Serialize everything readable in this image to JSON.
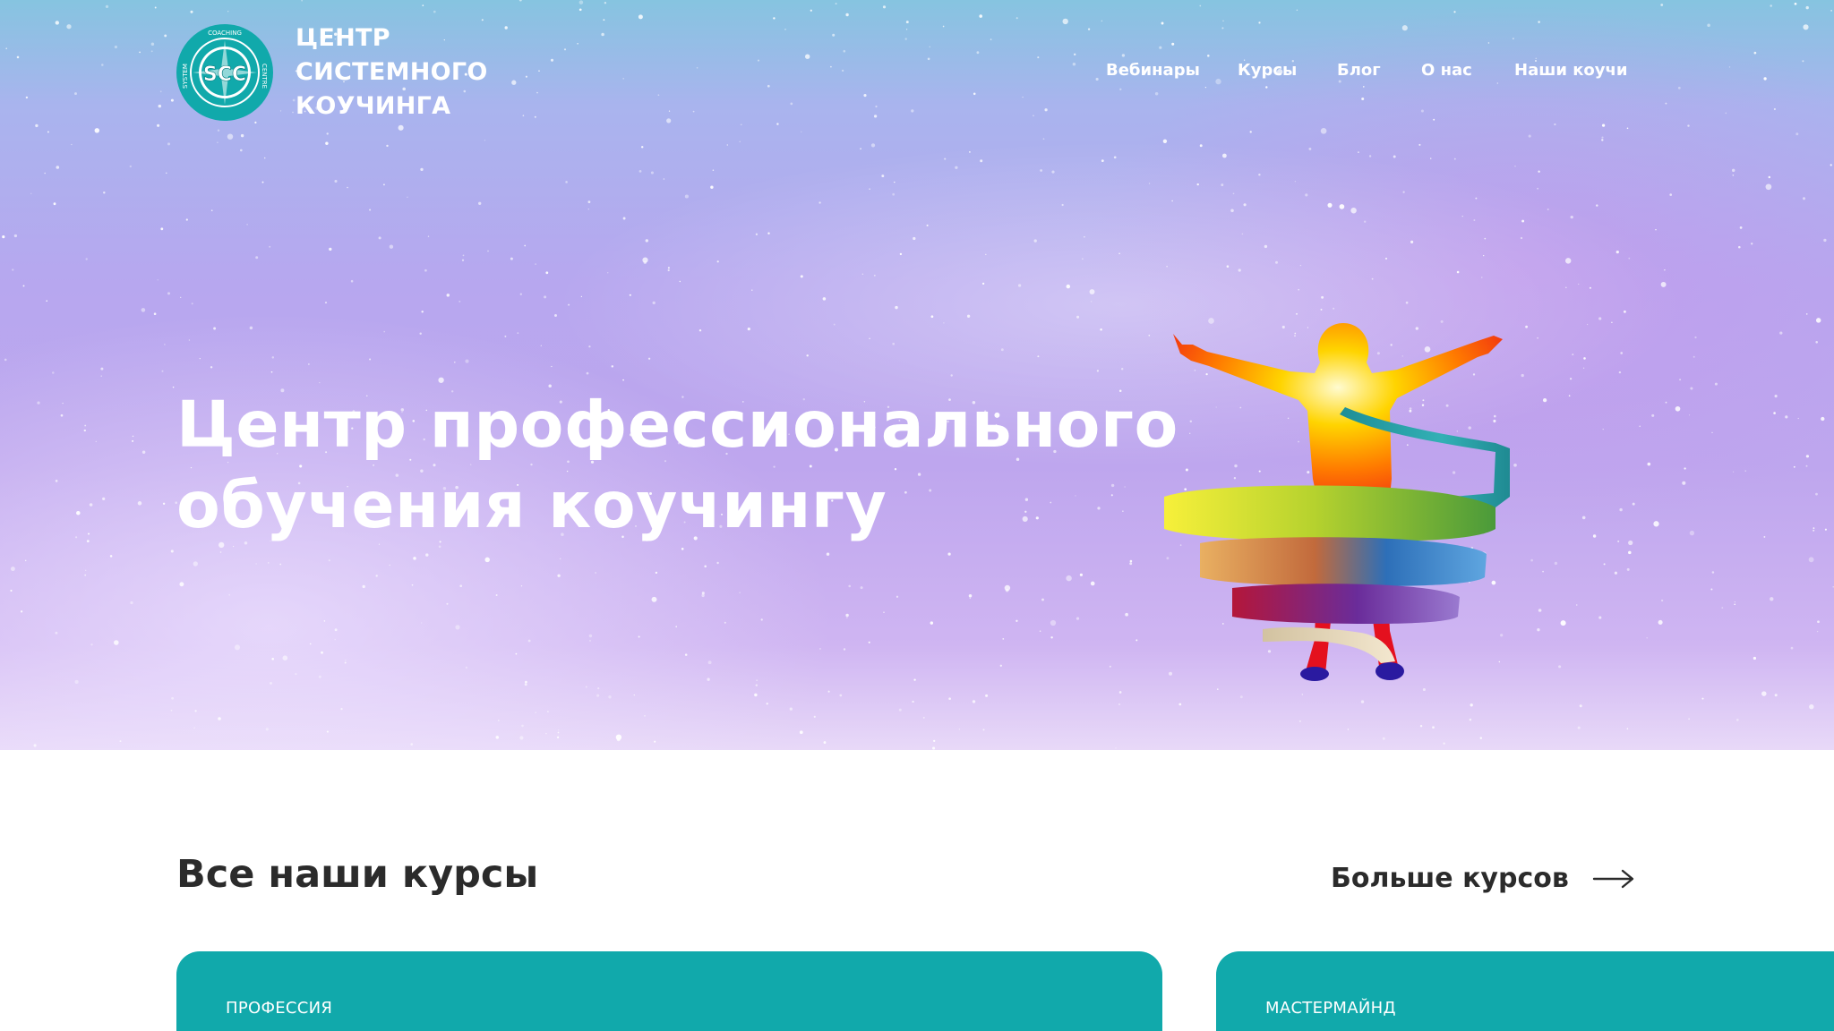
{
  "header": {
    "logo": {
      "icon": "scc-compass-logo-icon",
      "lettering": {
        "center": "SCC",
        "ring": [
          "COACHING",
          "CENTRE",
          "SYSTEM"
        ]
      },
      "color": "#11a9ab"
    },
    "brand_lines": [
      "ЦЕНТР",
      "СИСТЕМНОГО",
      "КОУЧИНГА"
    ],
    "nav": [
      "Вебинары",
      "Курсы",
      "Блог",
      "О нас",
      "Наши коучи"
    ]
  },
  "hero": {
    "title_lines": [
      "Центр профессионального",
      "обучения коучингу"
    ],
    "illustration": "rainbow-person-ribbon-illustration"
  },
  "courses": {
    "title": "Все наши курсы",
    "more_label": "Больше курсов",
    "more_icon": "arrow-right-icon",
    "cards": [
      {
        "tag": "ПРОФЕССИЯ"
      },
      {
        "tag": "МАСТЕРМАЙНД"
      }
    ]
  },
  "colors": {
    "accent": "#11a9ab",
    "text_dark": "#2b2b2b",
    "hero_text": "#ffffff"
  }
}
